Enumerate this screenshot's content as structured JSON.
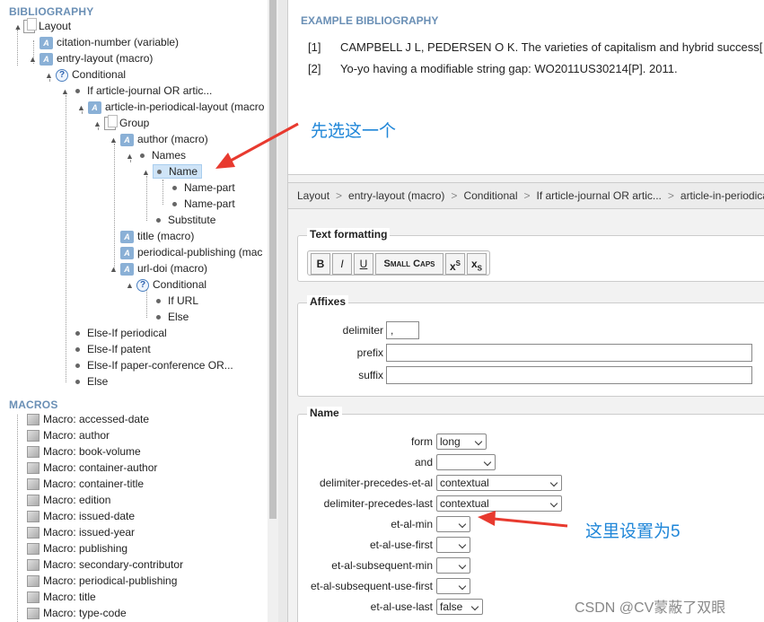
{
  "sidebar": {
    "bibliography_title": "BIBLIOGRAPHY",
    "macros_title": "MACROS",
    "tree": [
      {
        "label": "Layout",
        "icon": "page-icon"
      },
      {
        "label": "citation-number (variable)",
        "icon": "variable-icon"
      },
      {
        "label": "entry-layout (macro)",
        "icon": "macro-icon"
      },
      {
        "label": "Conditional",
        "icon": "question-icon"
      },
      {
        "label": "If article-journal OR artic...",
        "icon": "bullet-icon"
      },
      {
        "label": "article-in-periodical-layout (macro",
        "icon": "macro-icon"
      },
      {
        "label": "Group",
        "icon": "page-icon"
      },
      {
        "label": "author (macro)",
        "icon": "macro-icon"
      },
      {
        "label": "Names",
        "icon": "bullet-icon"
      },
      {
        "label": "Name",
        "icon": "bullet-icon"
      },
      {
        "label": "Name-part",
        "icon": "bullet-icon"
      },
      {
        "label": "Name-part",
        "icon": "bullet-icon"
      },
      {
        "label": "Substitute",
        "icon": "bullet-icon"
      },
      {
        "label": "title (macro)",
        "icon": "macro-icon"
      },
      {
        "label": "periodical-publishing (mac",
        "icon": "macro-icon"
      },
      {
        "label": "url-doi (macro)",
        "icon": "macro-icon"
      },
      {
        "label": "Conditional",
        "icon": "question-icon"
      },
      {
        "label": "If URL",
        "icon": "bullet-icon"
      },
      {
        "label": "Else",
        "icon": "bullet-icon"
      },
      {
        "label": "Else-If periodical",
        "icon": "bullet-icon"
      },
      {
        "label": "Else-If patent",
        "icon": "bullet-icon"
      },
      {
        "label": "Else-If paper-conference OR...",
        "icon": "bullet-icon"
      },
      {
        "label": "Else",
        "icon": "bullet-icon"
      }
    ],
    "macros": [
      "Macro: accessed-date",
      "Macro: author",
      "Macro: book-volume",
      "Macro: container-author",
      "Macro: container-title",
      "Macro: edition",
      "Macro: issued-date",
      "Macro: issued-year",
      "Macro: publishing",
      "Macro: secondary-contributor",
      "Macro: periodical-publishing",
      "Macro: title",
      "Macro: type-code"
    ]
  },
  "example": {
    "title": "EXAMPLE BIBLIOGRAPHY",
    "refs": [
      {
        "num": "[1]",
        "text": "CAMPBELL J L, PEDERSEN O K. The varieties of capitalism and hybrid success["
      },
      {
        "num": "[2]",
        "text": "Yo-yo having a modifiable string gap: WO2011US30214[P]. 2011."
      }
    ]
  },
  "breadcrumb": [
    "Layout",
    "entry-layout (macro)",
    "Conditional",
    "If article-journal OR artic...",
    "article-in-periodical-layout (macro)"
  ],
  "breadcrumb_sep": ">",
  "text_formatting": {
    "legend": "Text formatting",
    "buttons": [
      "B",
      "I",
      "U",
      "Small Caps",
      "x",
      "x"
    ],
    "sup": "S",
    "sub": "S"
  },
  "affixes": {
    "legend": "Affixes",
    "delimiter_label": "delimiter",
    "delimiter_value": ",",
    "prefix_label": "prefix",
    "prefix_value": "",
    "suffix_label": "suffix",
    "suffix_value": ""
  },
  "name_section": {
    "legend": "Name",
    "fields": [
      {
        "label": "form",
        "value": "long"
      },
      {
        "label": "and",
        "value": ""
      },
      {
        "label": "delimiter-precedes-et-al",
        "value": "contextual"
      },
      {
        "label": "delimiter-precedes-last",
        "value": "contextual"
      },
      {
        "label": "et-al-min",
        "value": ""
      },
      {
        "label": "et-al-use-first",
        "value": ""
      },
      {
        "label": "et-al-subsequent-min",
        "value": ""
      },
      {
        "label": "et-al-subsequent-use-first",
        "value": ""
      },
      {
        "label": "et-al-use-last",
        "value": "false"
      }
    ]
  },
  "annotations": {
    "first": "先选这一个",
    "second": "这里设置为5",
    "arrow_color": "#e83a2f",
    "text_color": "#1f86d8"
  },
  "watermark": "CSDN @CV蒙蔽了双眼",
  "colors": {
    "section_title": "#6a8fb5",
    "selected_bg": "#cfe4f7"
  }
}
